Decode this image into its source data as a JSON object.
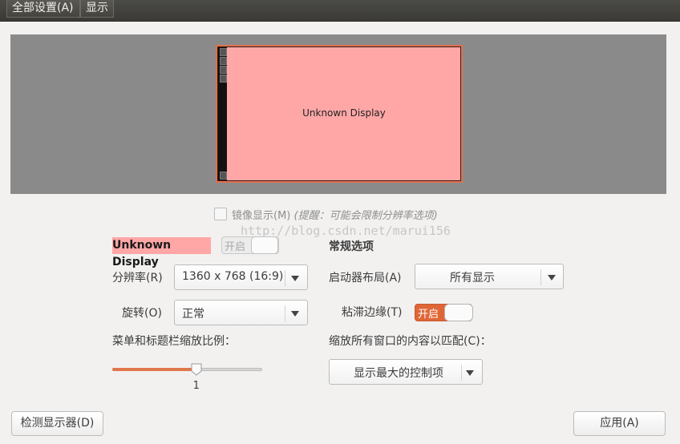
{
  "breadcrumb": {
    "all_settings": "全部设置(A)",
    "current": "显示"
  },
  "preview": {
    "monitor_label": "Unknown Display"
  },
  "mirror": {
    "label": "镜像显示(M)",
    "hint": "(提醒：可能会限制分辨率选项)",
    "checked": false
  },
  "watermark": "http://blog.csdn.net/marui156",
  "display": {
    "name": "Unknown Display",
    "toggle_label": "开启",
    "enabled": false,
    "resolution_label": "分辨率(R)",
    "resolution_value": "1360 x 768 (16:9)",
    "rotation_label": "旋转(O)",
    "rotation_value": "正常",
    "scale_label": "菜单和标题栏缩放比例：",
    "scale_value": "1",
    "scale_fraction": 0.56
  },
  "general": {
    "title": "常规选项",
    "launcher_label": "启动器布局(A)",
    "launcher_value": "所有显示",
    "sticky_label": "粘滞边缘(T)",
    "sticky_toggle_label": "开启",
    "sticky_enabled": true,
    "fit_label": "缩放所有窗口的内容以匹配(C)：",
    "fit_value": "显示最大的控制项"
  },
  "buttons": {
    "detect": "检测显示器(D)",
    "apply": "应用(A)"
  },
  "colors": {
    "accent": "#e06636",
    "monitor_fill": "#ffa7a7",
    "canvas": "#8a8a8a"
  }
}
